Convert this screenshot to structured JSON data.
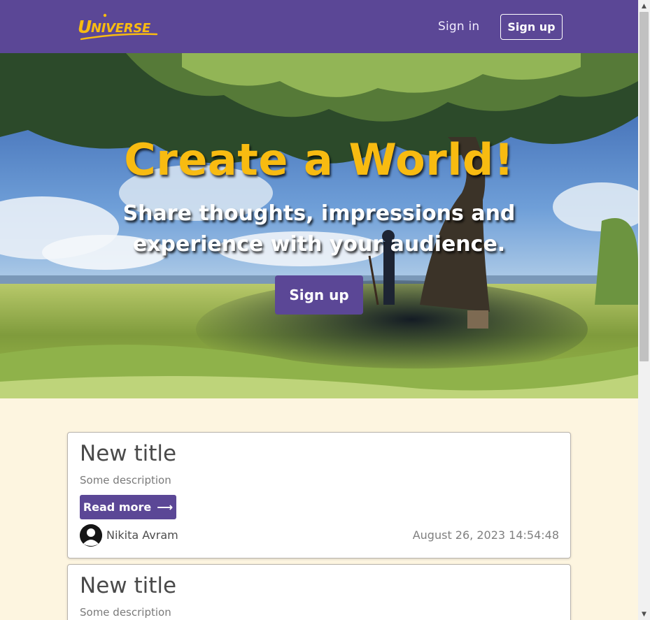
{
  "brand": {
    "logo_text": "UNIVERSE",
    "color": "#f8bb11"
  },
  "navbar": {
    "signin_label": "Sign in",
    "signup_label": "Sign up",
    "background": "#5b4796"
  },
  "hero": {
    "title": "Create a World!",
    "subtitle": "Share thoughts, impressions and experience with your audience.",
    "signup_label": "Sign up"
  },
  "posts": [
    {
      "title": "New title",
      "description": "Some description",
      "read_more_label": "Read more",
      "read_more_icon": "arrow-right-icon",
      "author": "Nikita Avram",
      "avatar_icon": "user-avatar-icon",
      "date": "August 26, 2023 14:54:48"
    },
    {
      "title": "New title",
      "description": "Some description"
    }
  ],
  "colors": {
    "page_background": "#fdf5e0",
    "accent": "#5b4796"
  }
}
